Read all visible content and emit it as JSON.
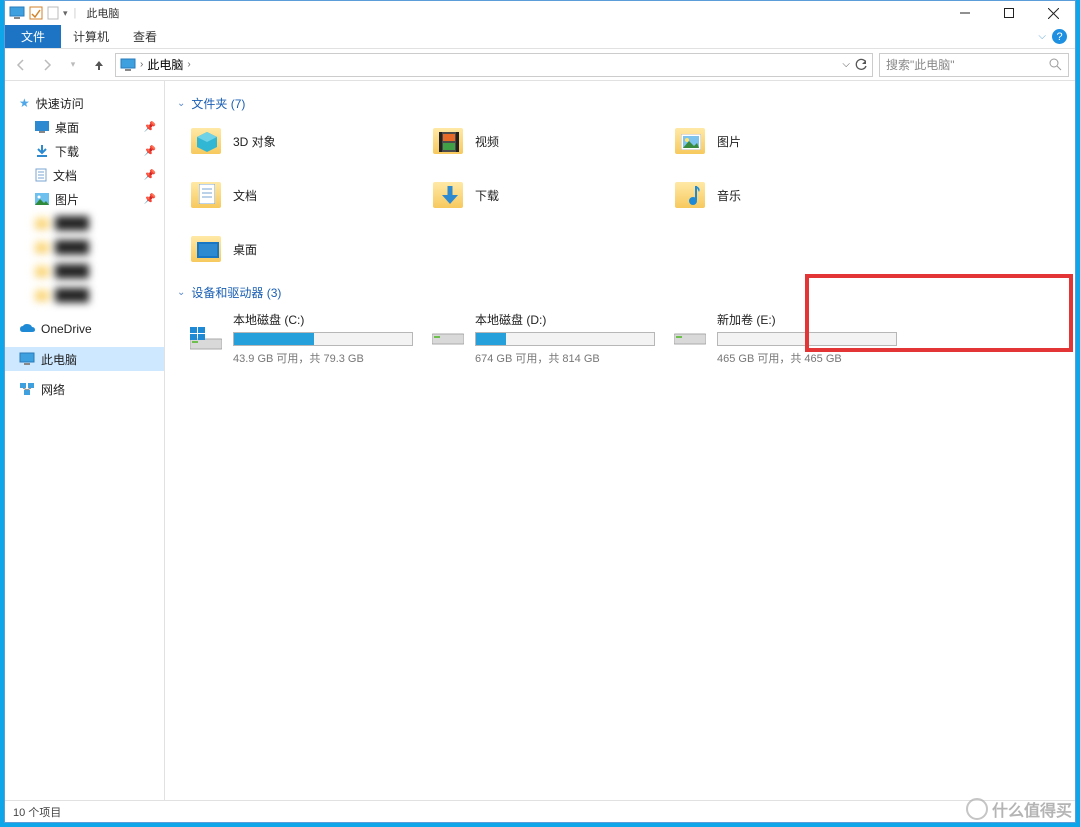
{
  "window_title": "此电脑",
  "ribbon": {
    "file": "文件",
    "computer": "计算机",
    "view": "查看"
  },
  "nav": {
    "location_label": "此电脑",
    "search_placeholder": "搜索\"此电脑\""
  },
  "sidebar": {
    "quick_access": "快速访问",
    "items": [
      {
        "label": "桌面",
        "icon": "desktop"
      },
      {
        "label": "下载",
        "icon": "download"
      },
      {
        "label": "文档",
        "icon": "document"
      },
      {
        "label": "图片",
        "icon": "picture"
      }
    ],
    "onedrive": "OneDrive",
    "this_pc": "此电脑",
    "network": "网络"
  },
  "groups": {
    "folders": {
      "title": "文件夹 (7)"
    },
    "devices": {
      "title": "设备和驱动器 (3)"
    }
  },
  "folders": [
    {
      "label": "3D 对象",
      "icon": "3d"
    },
    {
      "label": "视频",
      "icon": "video"
    },
    {
      "label": "图片",
      "icon": "picture"
    },
    {
      "label": "文档",
      "icon": "document"
    },
    {
      "label": "下载",
      "icon": "download"
    },
    {
      "label": "音乐",
      "icon": "music"
    },
    {
      "label": "桌面",
      "icon": "desktop"
    }
  ],
  "drives": [
    {
      "name": "本地磁盘 (C:)",
      "free": "43.9 GB 可用，共 79.3 GB",
      "used_pct": 45,
      "os": true
    },
    {
      "name": "本地磁盘 (D:)",
      "free": "674 GB 可用，共 814 GB",
      "used_pct": 17,
      "os": false
    },
    {
      "name": "新加卷 (E:)",
      "free": "465 GB 可用，共 465 GB",
      "used_pct": 0,
      "os": false,
      "highlight": true
    }
  ],
  "status": {
    "count": "10 个项目"
  },
  "watermark": "什么值得买"
}
